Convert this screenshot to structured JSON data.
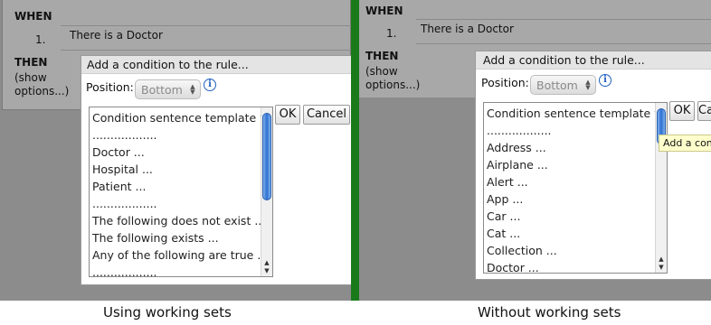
{
  "left": {
    "when_label": "WHEN",
    "condition_number": "1.",
    "condition_text": "There is a Doctor",
    "then_label": "THEN",
    "show_options_line1": "(show",
    "show_options_line2": "options...)",
    "popup_title": "Add a condition to the rule...",
    "position_label": "Position:",
    "position_value": "Bottom",
    "ok_label": "OK",
    "cancel_label": "Cancel",
    "list_items": [
      "Condition sentence template var",
      "..................",
      "Doctor ...",
      "Hospital ...",
      "Patient ...",
      "..................",
      "The following does not exist ...",
      "The following exists ...",
      "Any of the following are true ...",
      ".................."
    ]
  },
  "right": {
    "when_label": "WHEN",
    "condition_number": "1.",
    "condition_text": "There is a Doctor",
    "then_label": "THEN",
    "show_options_line1": "(show",
    "show_options_line2": "options...)",
    "popup_title": "Add a condition to the rule...",
    "position_label": "Position:",
    "position_value": "Bottom",
    "ok_label": "OK",
    "cancel_label": "Cancel",
    "tooltip": "Add a con",
    "list_items": [
      "Condition sentence template var",
      "..................",
      "Address ...",
      "Airplane ...",
      "Alert ...",
      "App ...",
      "Car ...",
      "Cat ...",
      "Collection ...",
      "Doctor ..."
    ]
  },
  "captions": {
    "left": "Using working sets",
    "right": "Without working sets"
  },
  "colors": {
    "divider": "#1a7a1a",
    "background": "#8c8c8c",
    "scroll_thumb": "#2f6fd0",
    "tooltip": "#ffffcc"
  },
  "icons": [
    "info-icon",
    "select-arrows-icon",
    "scroll-up-arrow-icon",
    "scroll-down-arrow-icon"
  ]
}
